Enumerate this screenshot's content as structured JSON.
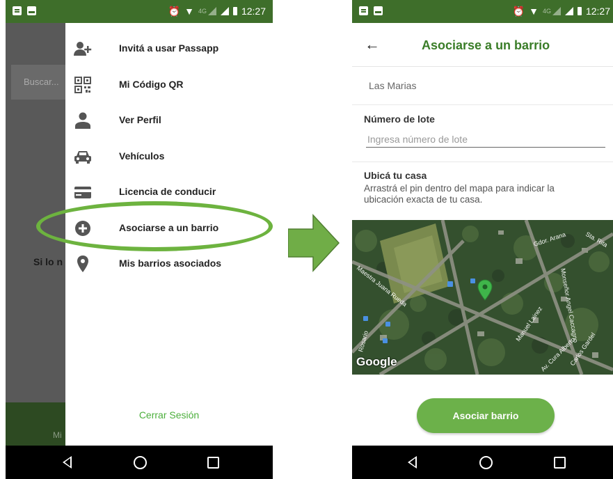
{
  "status_bar": {
    "time": "12:27",
    "network": "4G"
  },
  "phone1": {
    "background": {
      "search_placeholder": "Buscar...",
      "partial_text": "Si lo n",
      "bottom_partial": "Mi"
    },
    "drawer": {
      "items": [
        {
          "label": "Invitá a usar Passapp",
          "icon": "add-user-icon"
        },
        {
          "label": "Mi Código QR",
          "icon": "qr-code-icon"
        },
        {
          "label": "Ver Perfil",
          "icon": "person-icon"
        },
        {
          "label": "Vehículos",
          "icon": "car-icon"
        },
        {
          "label": "Licencia de conducir",
          "icon": "card-icon"
        },
        {
          "label": "Asociarse a un barrio",
          "icon": "plus-circle-icon"
        },
        {
          "label": "Mis barrios asociados",
          "icon": "location-pin-icon"
        }
      ],
      "logout": "Cerrar Sesión"
    }
  },
  "phone2": {
    "title": "Asociarse a un barrio",
    "barrio_value": "Las Marias",
    "lote": {
      "label": "Número de lote",
      "placeholder": "Ingresa número de lote"
    },
    "ubica": {
      "label": "Ubicá tu casa",
      "description": "Arrastrá el pin dentro del mapa para indicar la ubicación exacta de tu casa."
    },
    "map": {
      "attribution": "Google",
      "street_labels": [
        "Gdor. Arana",
        "Sta. Rita",
        "Maestra Juana Rueda",
        "Monseñor Angel Caccagno",
        "Manuel Lainez",
        "Rosario",
        "Av. Cura Alberto",
        "Carlos Gardel"
      ]
    },
    "button": "Asociar barrio"
  },
  "colors": {
    "status_bar": "#3e6e2a",
    "accent_green": "#6cb14a",
    "title_green": "#3a7d28",
    "highlight_ellipse": "#6db33f"
  }
}
